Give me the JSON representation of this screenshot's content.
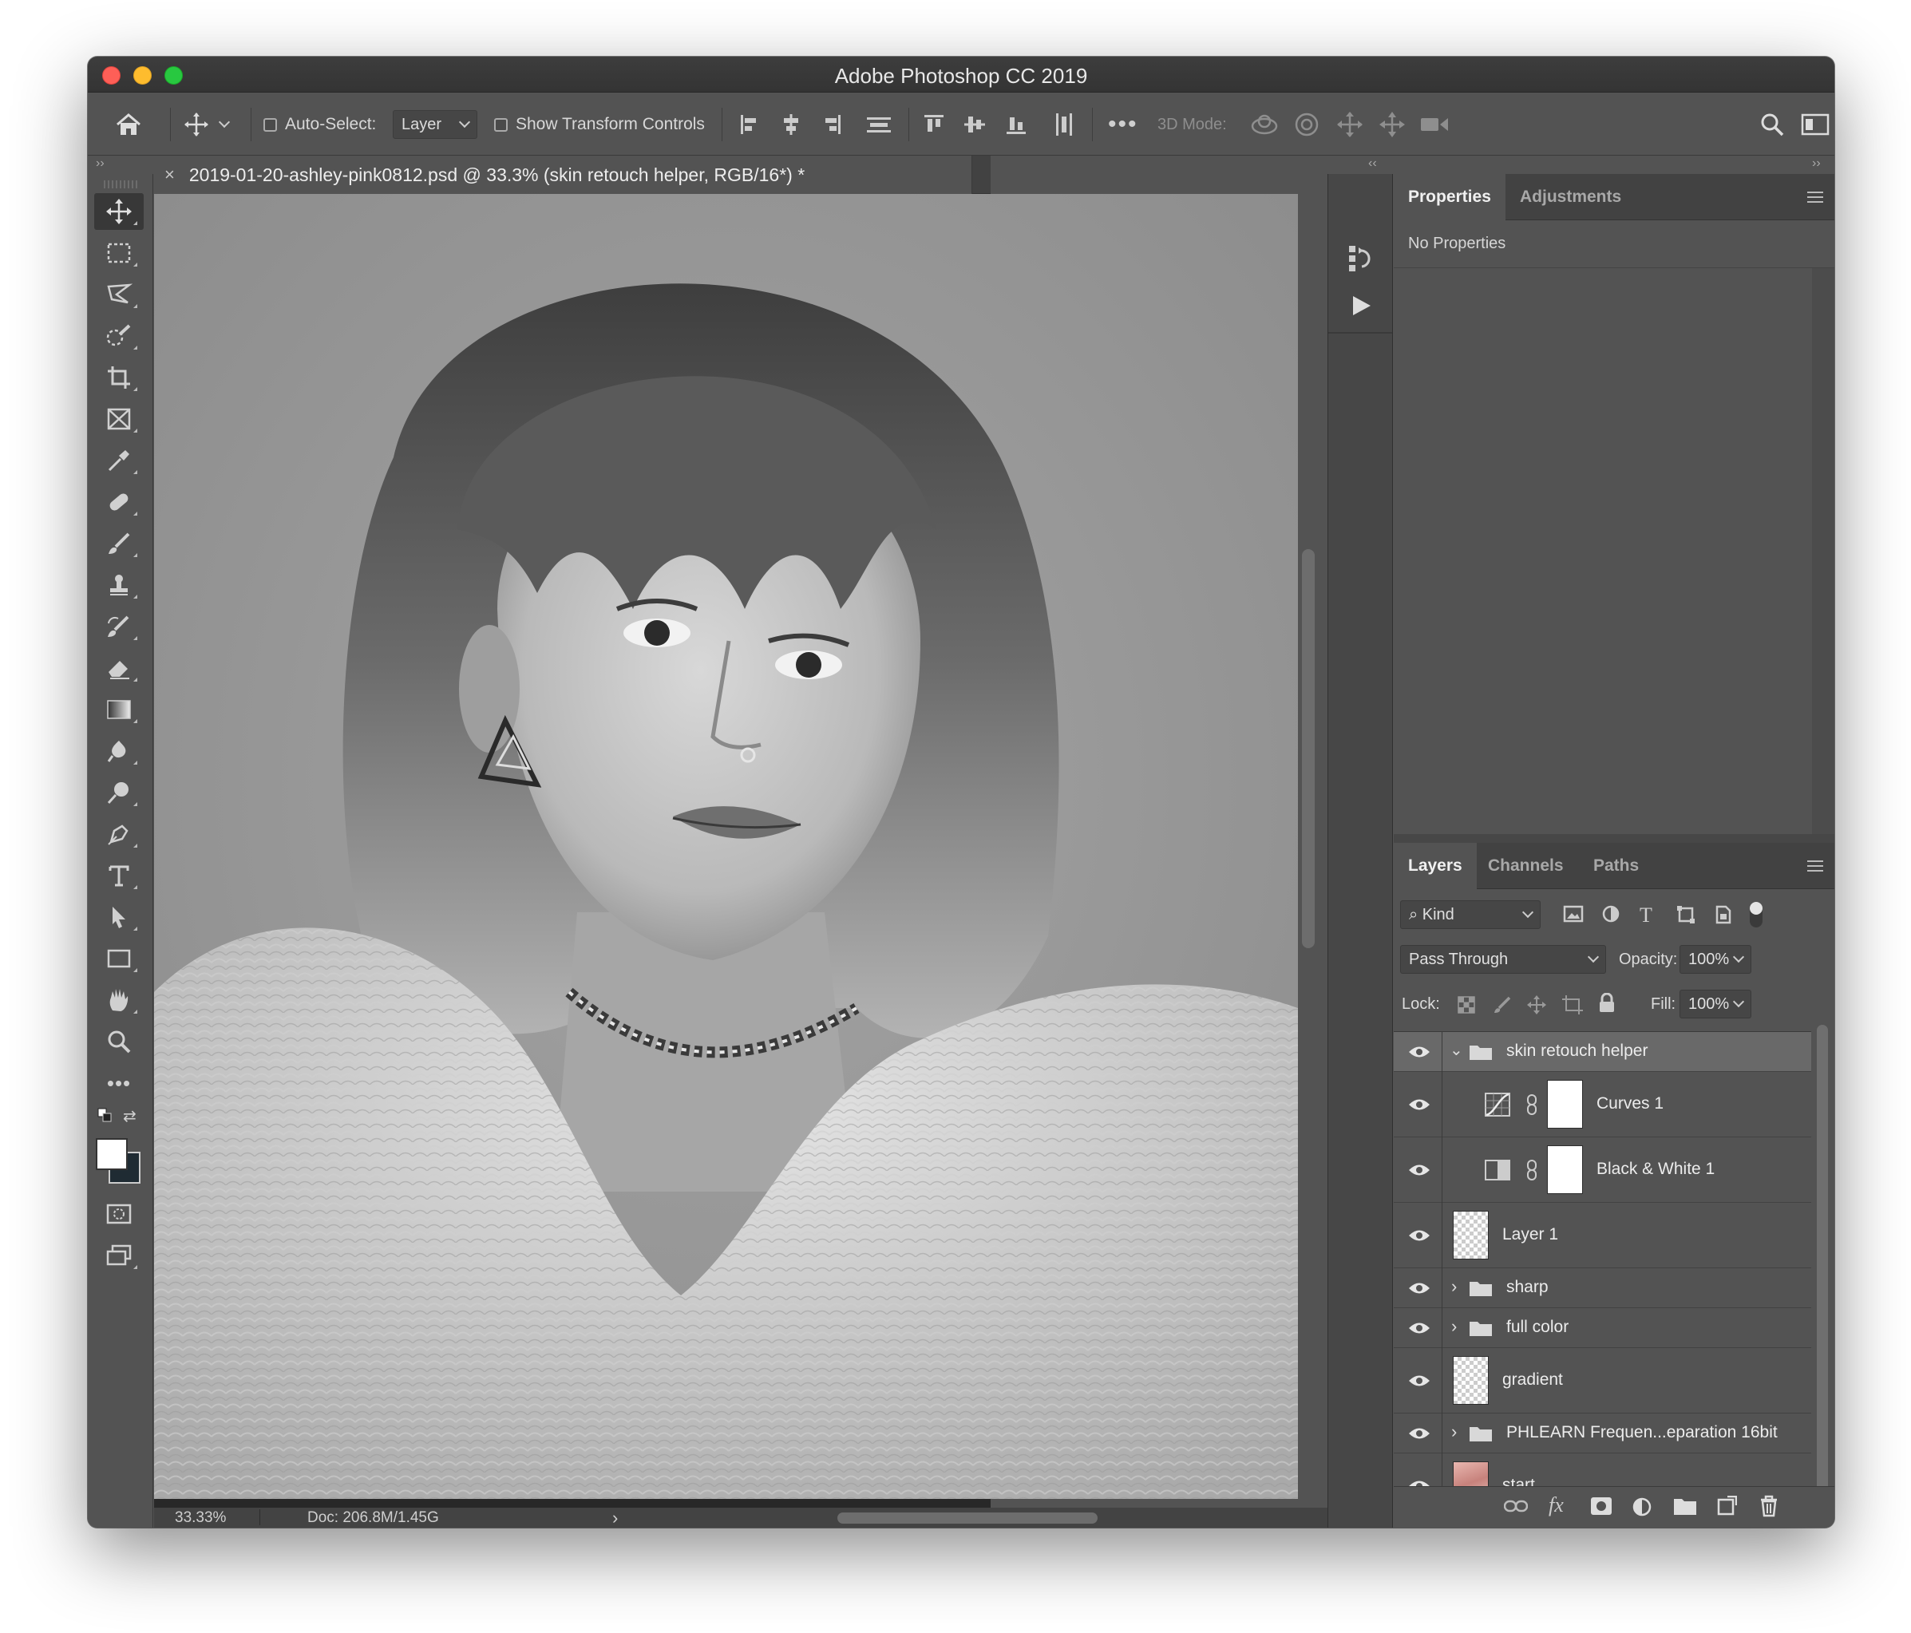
{
  "window": {
    "title": "Adobe Photoshop CC 2019"
  },
  "options_bar": {
    "auto_select_label": "Auto-Select:",
    "auto_select_value": "Layer",
    "show_transform_label": "Show Transform Controls",
    "mode_3d_label": "3D Mode:"
  },
  "document": {
    "tab_title": "2019-01-20-ashley-pink0812.psd @ 33.3% (skin retouch helper, RGB/16*) *",
    "close_glyph": "×"
  },
  "status": {
    "zoom": "33.33%",
    "doc_size": "Doc: 206.8M/1.45G",
    "arrow": "›"
  },
  "properties_panel": {
    "tabs": [
      "Properties",
      "Adjustments"
    ],
    "empty_text": "No Properties"
  },
  "layers_panel": {
    "tabs": [
      "Layers",
      "Channels",
      "Paths"
    ],
    "filter_kind": "Kind",
    "blend_mode": "Pass Through",
    "opacity_label": "Opacity:",
    "opacity_value": "100%",
    "lock_label": "Lock:",
    "fill_label": "Fill:",
    "fill_value": "100%",
    "layers": [
      {
        "name": "skin retouch helper",
        "type": "group",
        "expanded": true,
        "selected": true
      },
      {
        "name": "Curves 1",
        "type": "adjustment-curves",
        "indent": true
      },
      {
        "name": "Black & White 1",
        "type": "adjustment-bw",
        "indent": true
      },
      {
        "name": "Layer 1",
        "type": "pixel"
      },
      {
        "name": "sharp",
        "type": "group",
        "expanded": false
      },
      {
        "name": "full color",
        "type": "group",
        "expanded": false
      },
      {
        "name": "gradient",
        "type": "pixel"
      },
      {
        "name": "PHLEARN Frequen...eparation 16bit",
        "type": "group",
        "expanded": false
      },
      {
        "name": "start",
        "type": "photo"
      }
    ],
    "footer_fx": "fx"
  },
  "colors": {
    "panel_bg": "#535353",
    "selected_layer": "#696969",
    "foreground_swatch": "#ffffff",
    "background_swatch": "#1f2b33"
  }
}
